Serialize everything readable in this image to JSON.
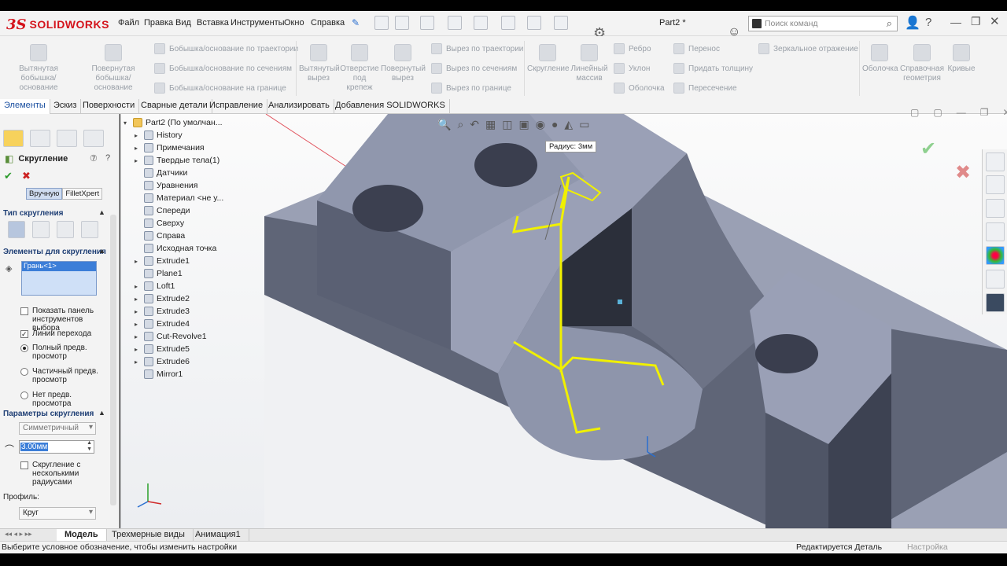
{
  "menu": {
    "items": [
      "Файл",
      "Правка",
      "Вид",
      "Вставка",
      "Инструменты",
      "Окно",
      "Справка"
    ],
    "doc_title": "Part2 *",
    "search_placeholder": "Поиск команд",
    "brand": "SOLIDWORKS"
  },
  "ribbon": {
    "big": [
      "Вытянутая бобышка/основание",
      "Повернутая бобышка/основание",
      "Вытянутый вырез",
      "Отверстие под крепеж",
      "Повернутый вырез",
      "Скругление",
      "Линейный массив",
      "Оболочка",
      "Справочная геометрия",
      "Кривые"
    ],
    "small": [
      "Бобышка/основание по траектории",
      "Бобышка/основание по сечениям",
      "Бобышка/основание на границе",
      "Вырез по траектории",
      "Вырез по сечениям",
      "Вырез по границе",
      "Ребро",
      "Уклон",
      "Оболочка",
      "Перенос",
      "Придать толщину",
      "Пересечение",
      "Зеркальное отражение"
    ]
  },
  "cm_tabs": [
    "Элементы",
    "Эскиз",
    "Поверхности",
    "Сварные детали",
    "Исправление",
    "Анализировать",
    "Добавления SOLIDWORKS"
  ],
  "property_manager": {
    "title": "Скругление",
    "modes": [
      "Вручную",
      "FilletXpert"
    ],
    "section_type": "Тип скругления",
    "section_items": "Элементы для скругления",
    "selected_item": "Грань<1>",
    "options": [
      {
        "label": "Показать панель инструментов выбора",
        "kind": "check",
        "on": false
      },
      {
        "label": "Линии перехода",
        "kind": "check",
        "on": true
      },
      {
        "label": "Полный предв. просмотр",
        "kind": "radio",
        "on": true
      },
      {
        "label": "Частичный предв. просмотр",
        "kind": "radio",
        "on": false
      },
      {
        "label": "Нет предв. просмотра",
        "kind": "radio",
        "on": false
      }
    ],
    "section_params": "Параметры скругления",
    "param_type": "Симметричный",
    "radius": "3.00мм",
    "multi_radius": "Скругление с несколькими радиусами",
    "profile_label": "Профиль:",
    "profile_value": "Круг"
  },
  "tree": {
    "root": "Part2  (По умолчан...",
    "items": [
      {
        "label": "History",
        "expand": true
      },
      {
        "label": "Примечания",
        "expand": true
      },
      {
        "label": "Твердые тела(1)",
        "expand": true
      },
      {
        "label": "Датчики",
        "expand": false
      },
      {
        "label": "Уравнения",
        "expand": false
      },
      {
        "label": "Материал <не у...",
        "expand": false
      },
      {
        "label": "Спереди",
        "expand": false
      },
      {
        "label": "Сверху",
        "expand": false
      },
      {
        "label": "Справа",
        "expand": false
      },
      {
        "label": "Исходная точка",
        "expand": false
      },
      {
        "label": "Extrude1",
        "expand": true
      },
      {
        "label": "Plane1",
        "expand": false
      },
      {
        "label": "Loft1",
        "expand": true
      },
      {
        "label": "Extrude2",
        "expand": true
      },
      {
        "label": "Extrude3",
        "expand": true
      },
      {
        "label": "Extrude4",
        "expand": true
      },
      {
        "label": "Cut-Revolve1",
        "expand": true
      },
      {
        "label": "Extrude5",
        "expand": true
      },
      {
        "label": "Extrude6",
        "expand": true
      },
      {
        "label": "Mirror1",
        "expand": false
      }
    ]
  },
  "viewport": {
    "tooltip": "Радиус: 3мм",
    "accent_model": "#8f96ab",
    "accent_highlight": "#f0f000"
  },
  "bottom_tabs": [
    "Модель",
    "Трехмерные виды",
    "Анимация1"
  ],
  "status": {
    "left": "Выберите условное обозначение, чтобы изменить настройки",
    "mid": "Редактируется Деталь",
    "right": "Настройка"
  }
}
